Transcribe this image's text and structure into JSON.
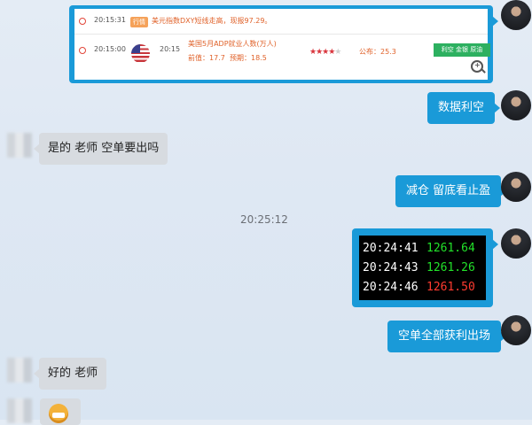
{
  "calendar_card": {
    "row1": {
      "time": "20:15:31",
      "tag": "行情",
      "text": "美元指数DXY短线走高，现报97.29。"
    },
    "row2": {
      "time": "20:15:00",
      "release_time": "20:15",
      "title": "美国5月ADP就业人数(万人)",
      "previous": "前值：17.7",
      "forecast": "预期：18.5",
      "importance_stars": 4,
      "importance_max": 5,
      "actual": "公布：25.3",
      "impact_button": "利空 金银 原油"
    }
  },
  "messages": {
    "m1": "数据利空",
    "m2": "是的 老师 空单要出吗",
    "m3": "减仓 留底看止盈",
    "timestamp": "20:25:12",
    "m5": "空单全部获利出场",
    "m6": "好的 老师"
  },
  "ticker": {
    "rows": [
      {
        "time": "20:24:41",
        "price": "1261.64",
        "color": "#22e22a"
      },
      {
        "time": "20:24:43",
        "price": "1261.26",
        "color": "#22e22a"
      },
      {
        "time": "20:24:46",
        "price": "1261.50",
        "color": "#ff3b30"
      }
    ]
  },
  "colors": {
    "own_bubble": "#1a9ad8",
    "peer_bubble": "#d7dbe0",
    "alert_tag": "#f5a25a",
    "impact_button": "#2db060"
  },
  "icons": {
    "alarm": "alarm-clock-icon",
    "flag": "us-flag-icon",
    "zoom": "zoom-in-icon",
    "emoji": "grinning-emoji-icon"
  }
}
